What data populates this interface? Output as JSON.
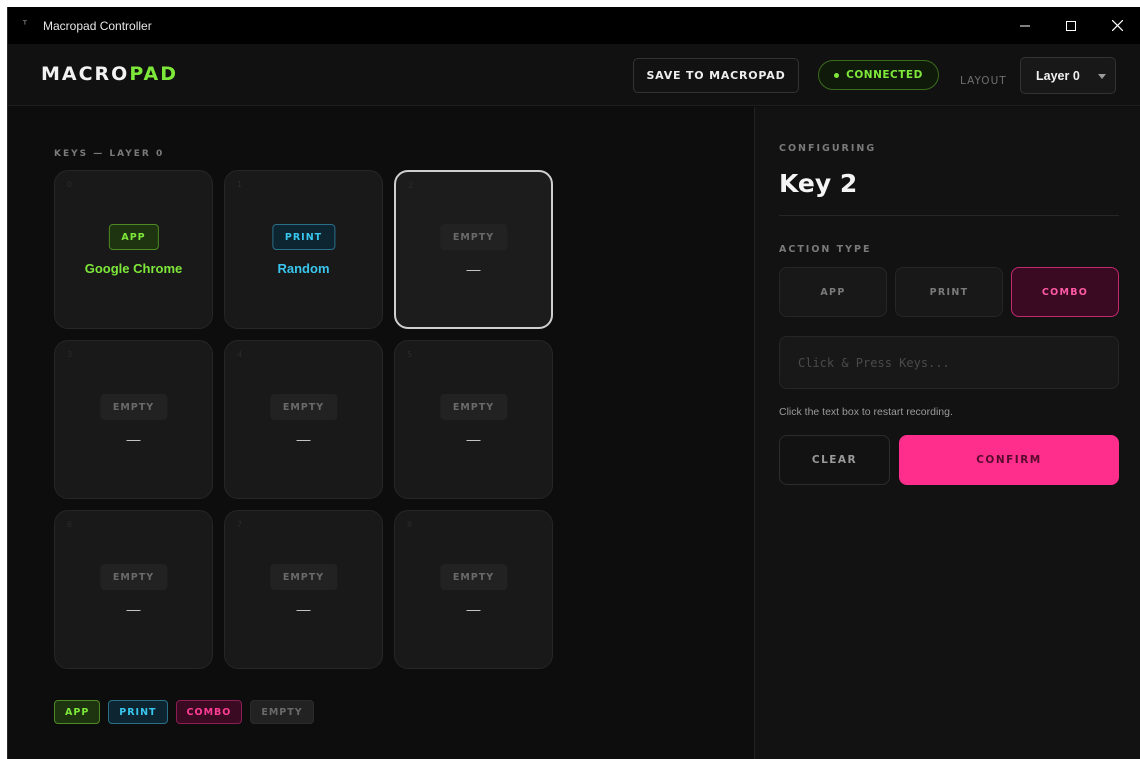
{
  "window": {
    "title": "Macropad Controller",
    "icon": "macropad-app-icon"
  },
  "header": {
    "logo_a": "MACRO",
    "logo_b": "PAD",
    "save_label": "SAVE TO MACROPAD",
    "connection_status": "CONNECTED",
    "layout_label": "LAYOUT",
    "layer_selected": "Layer 0"
  },
  "colors": {
    "app": "#7ee83a",
    "print": "#39c6ee",
    "combo": "#ff2d8c",
    "background": "#0d0d0d"
  },
  "keys_section": {
    "label": "KEYS — LAYER 0",
    "keys": [
      {
        "num": "0",
        "type_label": "APP",
        "type": "app",
        "value": "Google Chrome"
      },
      {
        "num": "1",
        "type_label": "PRINT",
        "type": "print",
        "value": "Random"
      },
      {
        "num": "2",
        "type_label": "EMPTY",
        "type": "empty",
        "value": "—",
        "selected": true
      },
      {
        "num": "3",
        "type_label": "EMPTY",
        "type": "empty",
        "value": "—"
      },
      {
        "num": "4",
        "type_label": "EMPTY",
        "type": "empty",
        "value": "—"
      },
      {
        "num": "5",
        "type_label": "EMPTY",
        "type": "empty",
        "value": "—"
      },
      {
        "num": "6",
        "type_label": "EMPTY",
        "type": "empty",
        "value": "—"
      },
      {
        "num": "7",
        "type_label": "EMPTY",
        "type": "empty",
        "value": "—"
      },
      {
        "num": "8",
        "type_label": "EMPTY",
        "type": "empty",
        "value": "—"
      }
    ]
  },
  "legend": [
    "APP",
    "PRINT",
    "COMBO",
    "EMPTY"
  ],
  "panel": {
    "configuring_label": "CONFIGURING",
    "key_title": "Key 2",
    "action_type_label": "ACTION TYPE",
    "action_types": [
      "APP",
      "PRINT",
      "COMBO"
    ],
    "active_action": "COMBO",
    "record_placeholder": "Click & Press Keys...",
    "hint": "Click the text box to restart recording.",
    "clear_label": "CLEAR",
    "confirm_label": "CONFIRM"
  }
}
